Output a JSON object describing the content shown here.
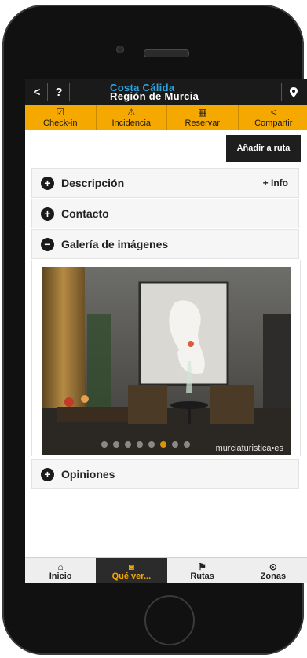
{
  "header": {
    "back_label": "<",
    "help_label": "?",
    "brand_line1": "Costa Cálida",
    "brand_line2": "Región de Murcia"
  },
  "actions": [
    {
      "label": "Check-in",
      "icon": "checkbox-icon"
    },
    {
      "label": "Incidencia",
      "icon": "alert-icon"
    },
    {
      "label": "Reservar",
      "icon": "calendar-icon"
    },
    {
      "label": "Compartir",
      "icon": "share-icon"
    }
  ],
  "add_route_label": "Añadir a ruta",
  "sections": {
    "descripcion": {
      "label": "Descripción",
      "extra": "+ Info",
      "state": "+"
    },
    "contacto": {
      "label": "Contacto",
      "state": "+"
    },
    "galeria": {
      "label": "Galería de imágenes",
      "state": "−"
    },
    "opiniones": {
      "label": "Opiniones",
      "state": "+"
    }
  },
  "gallery": {
    "watermark": "murciaturistica•es",
    "slide_count": 8,
    "active_slide": 5
  },
  "bottom_nav": [
    {
      "label": "Inicio",
      "icon": "home-icon"
    },
    {
      "label": "Qué ver...",
      "icon": "camera-icon",
      "active": true
    },
    {
      "label": "Rutas",
      "icon": "signpost-icon"
    },
    {
      "label": "Zonas",
      "icon": "location-icon"
    }
  ],
  "colors": {
    "accent": "#f5a800",
    "brand_blue": "#29a6e0",
    "dark": "#1a1a1a"
  }
}
